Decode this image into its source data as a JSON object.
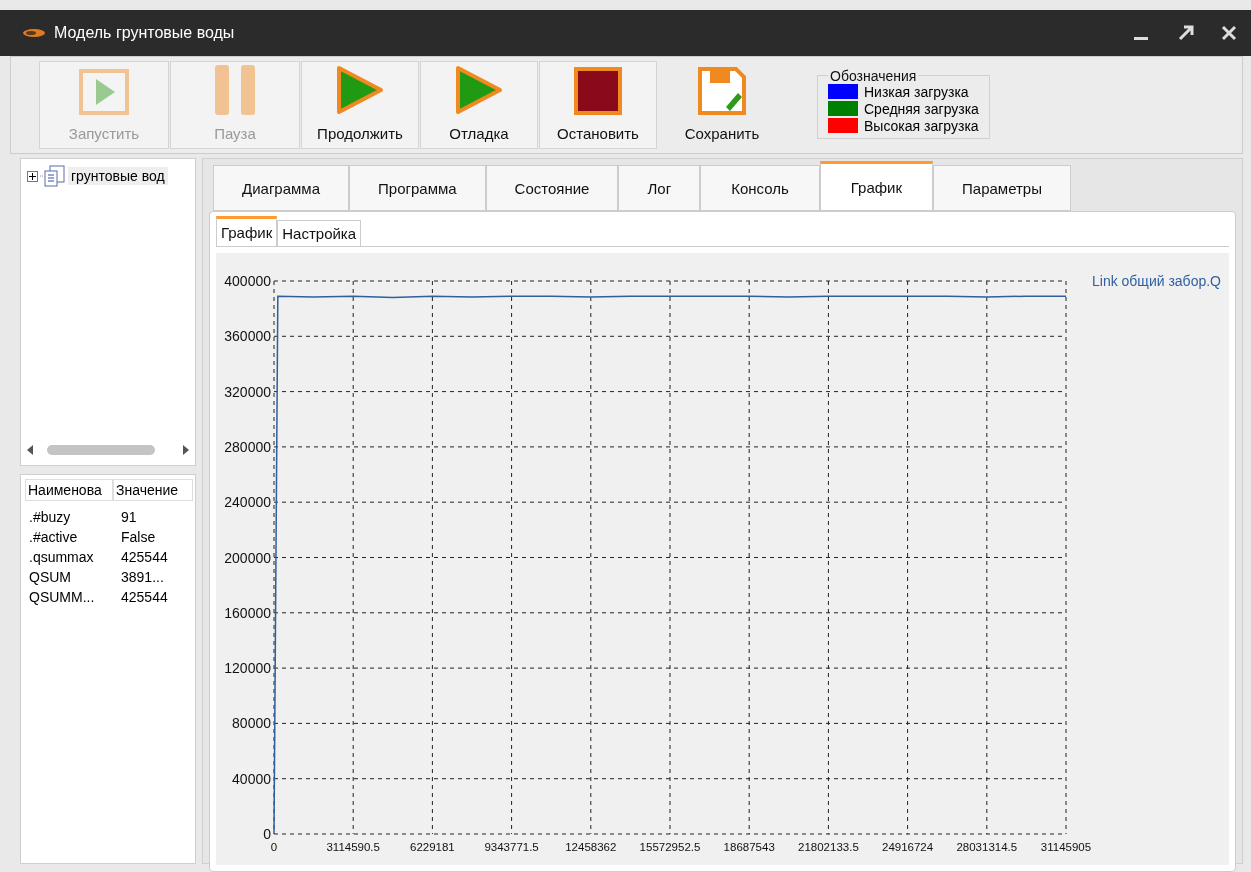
{
  "window": {
    "title": "Модель грунтовые воды"
  },
  "toolbar": [
    {
      "label": "Запустить",
      "kind": "start",
      "disabled": true
    },
    {
      "label": "Пауза",
      "kind": "pause",
      "disabled": true
    },
    {
      "label": "Продолжить",
      "kind": "play",
      "disabled": false
    },
    {
      "label": "Отладка",
      "kind": "play",
      "disabled": false
    },
    {
      "label": "Остановить",
      "kind": "stop",
      "disabled": false
    },
    {
      "label": "Сохранить",
      "kind": "save",
      "disabled": false
    }
  ],
  "legend": {
    "title": "Обозначения",
    "items": [
      {
        "label": "Низкая загрузка",
        "color": "#0000ff"
      },
      {
        "label": "Средняя загрузка",
        "color": "#008000"
      },
      {
        "label": "Высокая загрузка",
        "color": "#ff0000"
      }
    ]
  },
  "tree": {
    "items": [
      {
        "label": "грунтовые вод",
        "expanded": false
      }
    ]
  },
  "properties": {
    "columns": [
      "Наименова",
      "Значение"
    ],
    "rows": [
      [
        ".#buzy",
        "91"
      ],
      [
        ".#active",
        "False"
      ],
      [
        ".qsummax",
        "425544"
      ],
      [
        "QSUM",
        "3891..."
      ],
      [
        "QSUMM...",
        "425544"
      ]
    ]
  },
  "tabs": [
    {
      "label": "Диаграмма",
      "selected": false
    },
    {
      "label": "Программа",
      "selected": false
    },
    {
      "label": "Состояние",
      "selected": false
    },
    {
      "label": "Лог",
      "selected": false
    },
    {
      "label": "Консоль",
      "selected": false
    },
    {
      "label": "График",
      "selected": true
    },
    {
      "label": "Параметры",
      "selected": false
    }
  ],
  "subtabs": [
    {
      "label": "График",
      "selected": true
    },
    {
      "label": "Настройка",
      "selected": false
    }
  ],
  "chart_data": {
    "type": "line",
    "x": [
      0,
      150000,
      1557295,
      3114590.5,
      4671885.75,
      6229181,
      7786476.25,
      9343771.5,
      10901066.75,
      12458362,
      14015657.25,
      15572952.5,
      17130247.75,
      18687543,
      20244838.25,
      21802133.5,
      23359428.75,
      24916724,
      26474019.25,
      28031314.5,
      29588609.75,
      31145905
    ],
    "series": [
      {
        "name": "Link общий забор.Q",
        "color": "#2f5f9f",
        "values": [
          0,
          389000,
          388500,
          389000,
          388000,
          389000,
          388500,
          389000,
          389000,
          388500,
          389000,
          389000,
          389000,
          389000,
          388500,
          389000,
          389000,
          389000,
          389000,
          388500,
          389000,
          389000
        ]
      }
    ],
    "grid": true,
    "xlim": [
      0,
      31145905
    ],
    "ylim": [
      0,
      400000
    ],
    "xticks": [
      0,
      3114590.5,
      6229181,
      9343771.5,
      12458362,
      15572952.5,
      18687543,
      21802133.5,
      24916724,
      28031314.5,
      31145905
    ],
    "yticks": [
      0,
      40000,
      80000,
      120000,
      160000,
      200000,
      240000,
      280000,
      320000,
      360000,
      400000
    ]
  }
}
